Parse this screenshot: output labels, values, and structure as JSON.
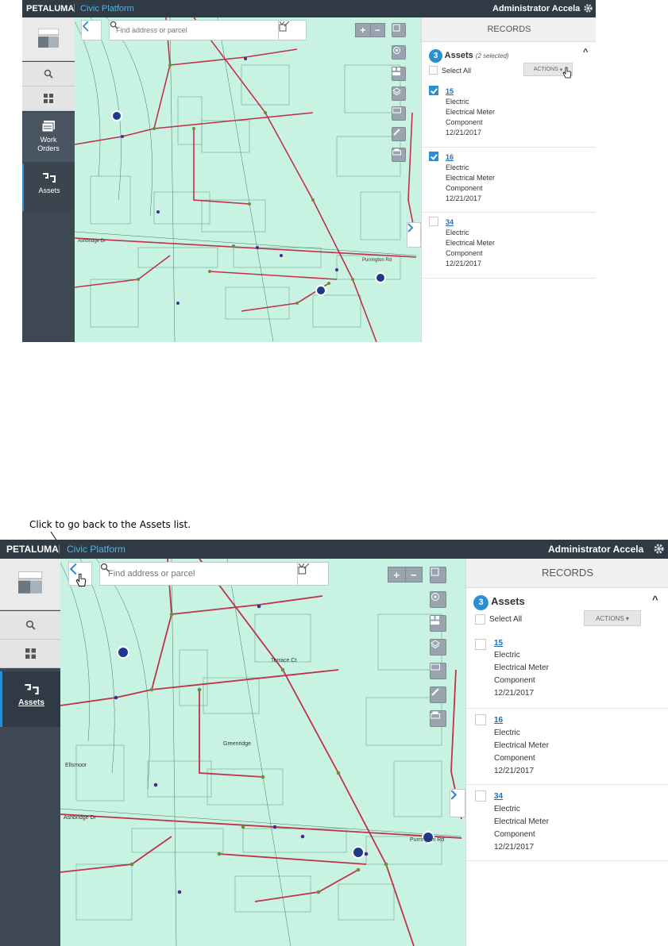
{
  "screen1": {
    "header": {
      "brand": "PETALUMA",
      "separator": "|",
      "platform": "Civic Platform",
      "user": "Administrator Accela"
    },
    "nav": {
      "work_orders_line1": "Work",
      "work_orders_line2": "Orders",
      "assets": "Assets"
    },
    "search": {
      "placeholder": "Find address or parcel"
    },
    "zoom": {
      "plus": "+",
      "minus": "−"
    },
    "panel": {
      "title": "RECORDS",
      "count": "3",
      "assets_label": "Assets",
      "selected_note": "(2 selected)",
      "select_all": "Select All",
      "actions": "ACTIONS",
      "records": [
        {
          "id": "15",
          "type": "Electric",
          "subtype": "Electrical Meter",
          "category": "Component",
          "date": "12/21/2017",
          "checked": true
        },
        {
          "id": "16",
          "type": "Electric",
          "subtype": "Electrical Meter",
          "category": "Component",
          "date": "12/21/2017",
          "checked": true
        },
        {
          "id": "34",
          "type": "Electric",
          "subtype": "Electrical Meter",
          "category": "Component",
          "date": "12/21/2017",
          "checked": false
        }
      ]
    },
    "map_labels": {
      "street_a": "Ashbridge Dr",
      "street_b": "Purrington Rd"
    }
  },
  "callout": "Click to go back to the Assets list.",
  "screen2": {
    "header": {
      "brand": "PETALUMA",
      "separator": "|",
      "platform": "Civic Platform",
      "user": "Administrator Accela"
    },
    "nav": {
      "assets": "Assets"
    },
    "search": {
      "placeholder": "Find address or parcel"
    },
    "zoom": {
      "plus": "+",
      "minus": "−"
    },
    "panel": {
      "title": "RECORDS",
      "count": "3",
      "assets_label": "Assets",
      "select_all": "Select All",
      "actions": "ACTIONS",
      "records": [
        {
          "id": "15",
          "type": "Electric",
          "subtype": "Electrical Meter",
          "category": "Component",
          "date": "12/21/2017",
          "checked": false
        },
        {
          "id": "16",
          "type": "Electric",
          "subtype": "Electrical Meter",
          "category": "Component",
          "date": "12/21/2017",
          "checked": false
        },
        {
          "id": "34",
          "type": "Electric",
          "subtype": "Electrical Meter",
          "category": "Component",
          "date": "12/21/2017",
          "checked": false
        }
      ]
    },
    "map_labels": {
      "street_a": "Ashbridge Dr",
      "street_b": "Purrington Rd",
      "street_c": "Terrace Ct",
      "street_d": "Greenridge",
      "street_e": "Ellsmoor"
    }
  },
  "colors": {
    "accent": "#2a8fd0",
    "topbar": "#2f3a45",
    "map_bg": "#c8f3e2",
    "road": "#c0314a"
  }
}
